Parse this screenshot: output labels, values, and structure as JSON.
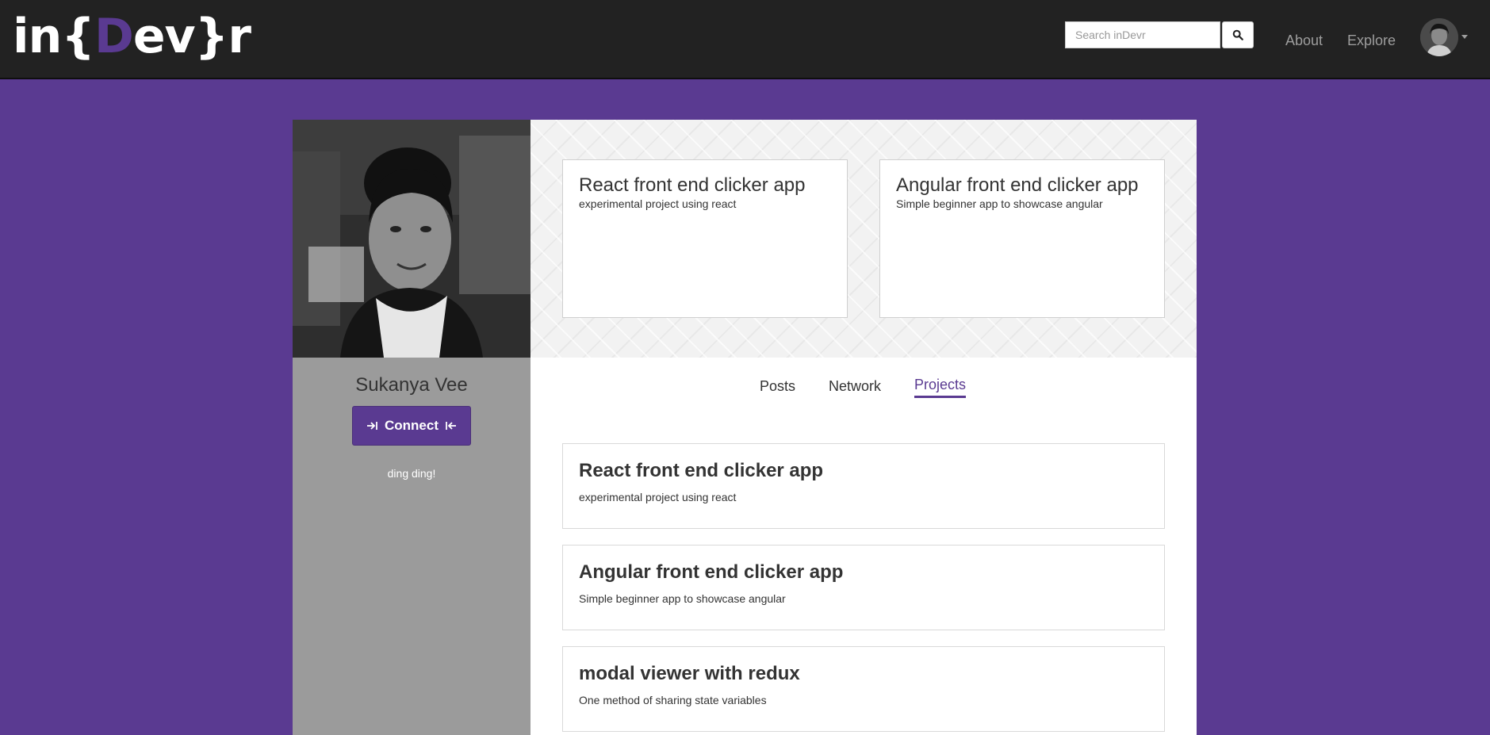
{
  "nav": {
    "logo": {
      "prefix": "in{",
      "accent": "D",
      "suffix": "ev}r"
    },
    "search": {
      "placeholder": "Search inDevr"
    },
    "links": [
      "About",
      "Explore"
    ],
    "search_icon": "search-icon",
    "avatar_icon": "user-avatar"
  },
  "profile": {
    "name": "Sukanya Vee",
    "connect_label": "Connect",
    "bio": "ding ding!"
  },
  "featured": [
    {
      "title": "React front end clicker app",
      "desc": "experimental project using react"
    },
    {
      "title": "Angular front end clicker app",
      "desc": "Simple beginner app to showcase angular"
    }
  ],
  "tabs": [
    "Posts",
    "Network",
    "Projects"
  ],
  "active_tab": "Projects",
  "projects": [
    {
      "title": "React front end clicker app",
      "desc": "experimental project using react"
    },
    {
      "title": "Angular front end clicker app",
      "desc": "Simple beginner app to showcase angular"
    },
    {
      "title": "modal viewer with redux",
      "desc": "One method of sharing state variables"
    }
  ],
  "colors": {
    "brand": "#5a3a91",
    "navbar": "#222222",
    "sidebar": "#9b9b9b"
  }
}
